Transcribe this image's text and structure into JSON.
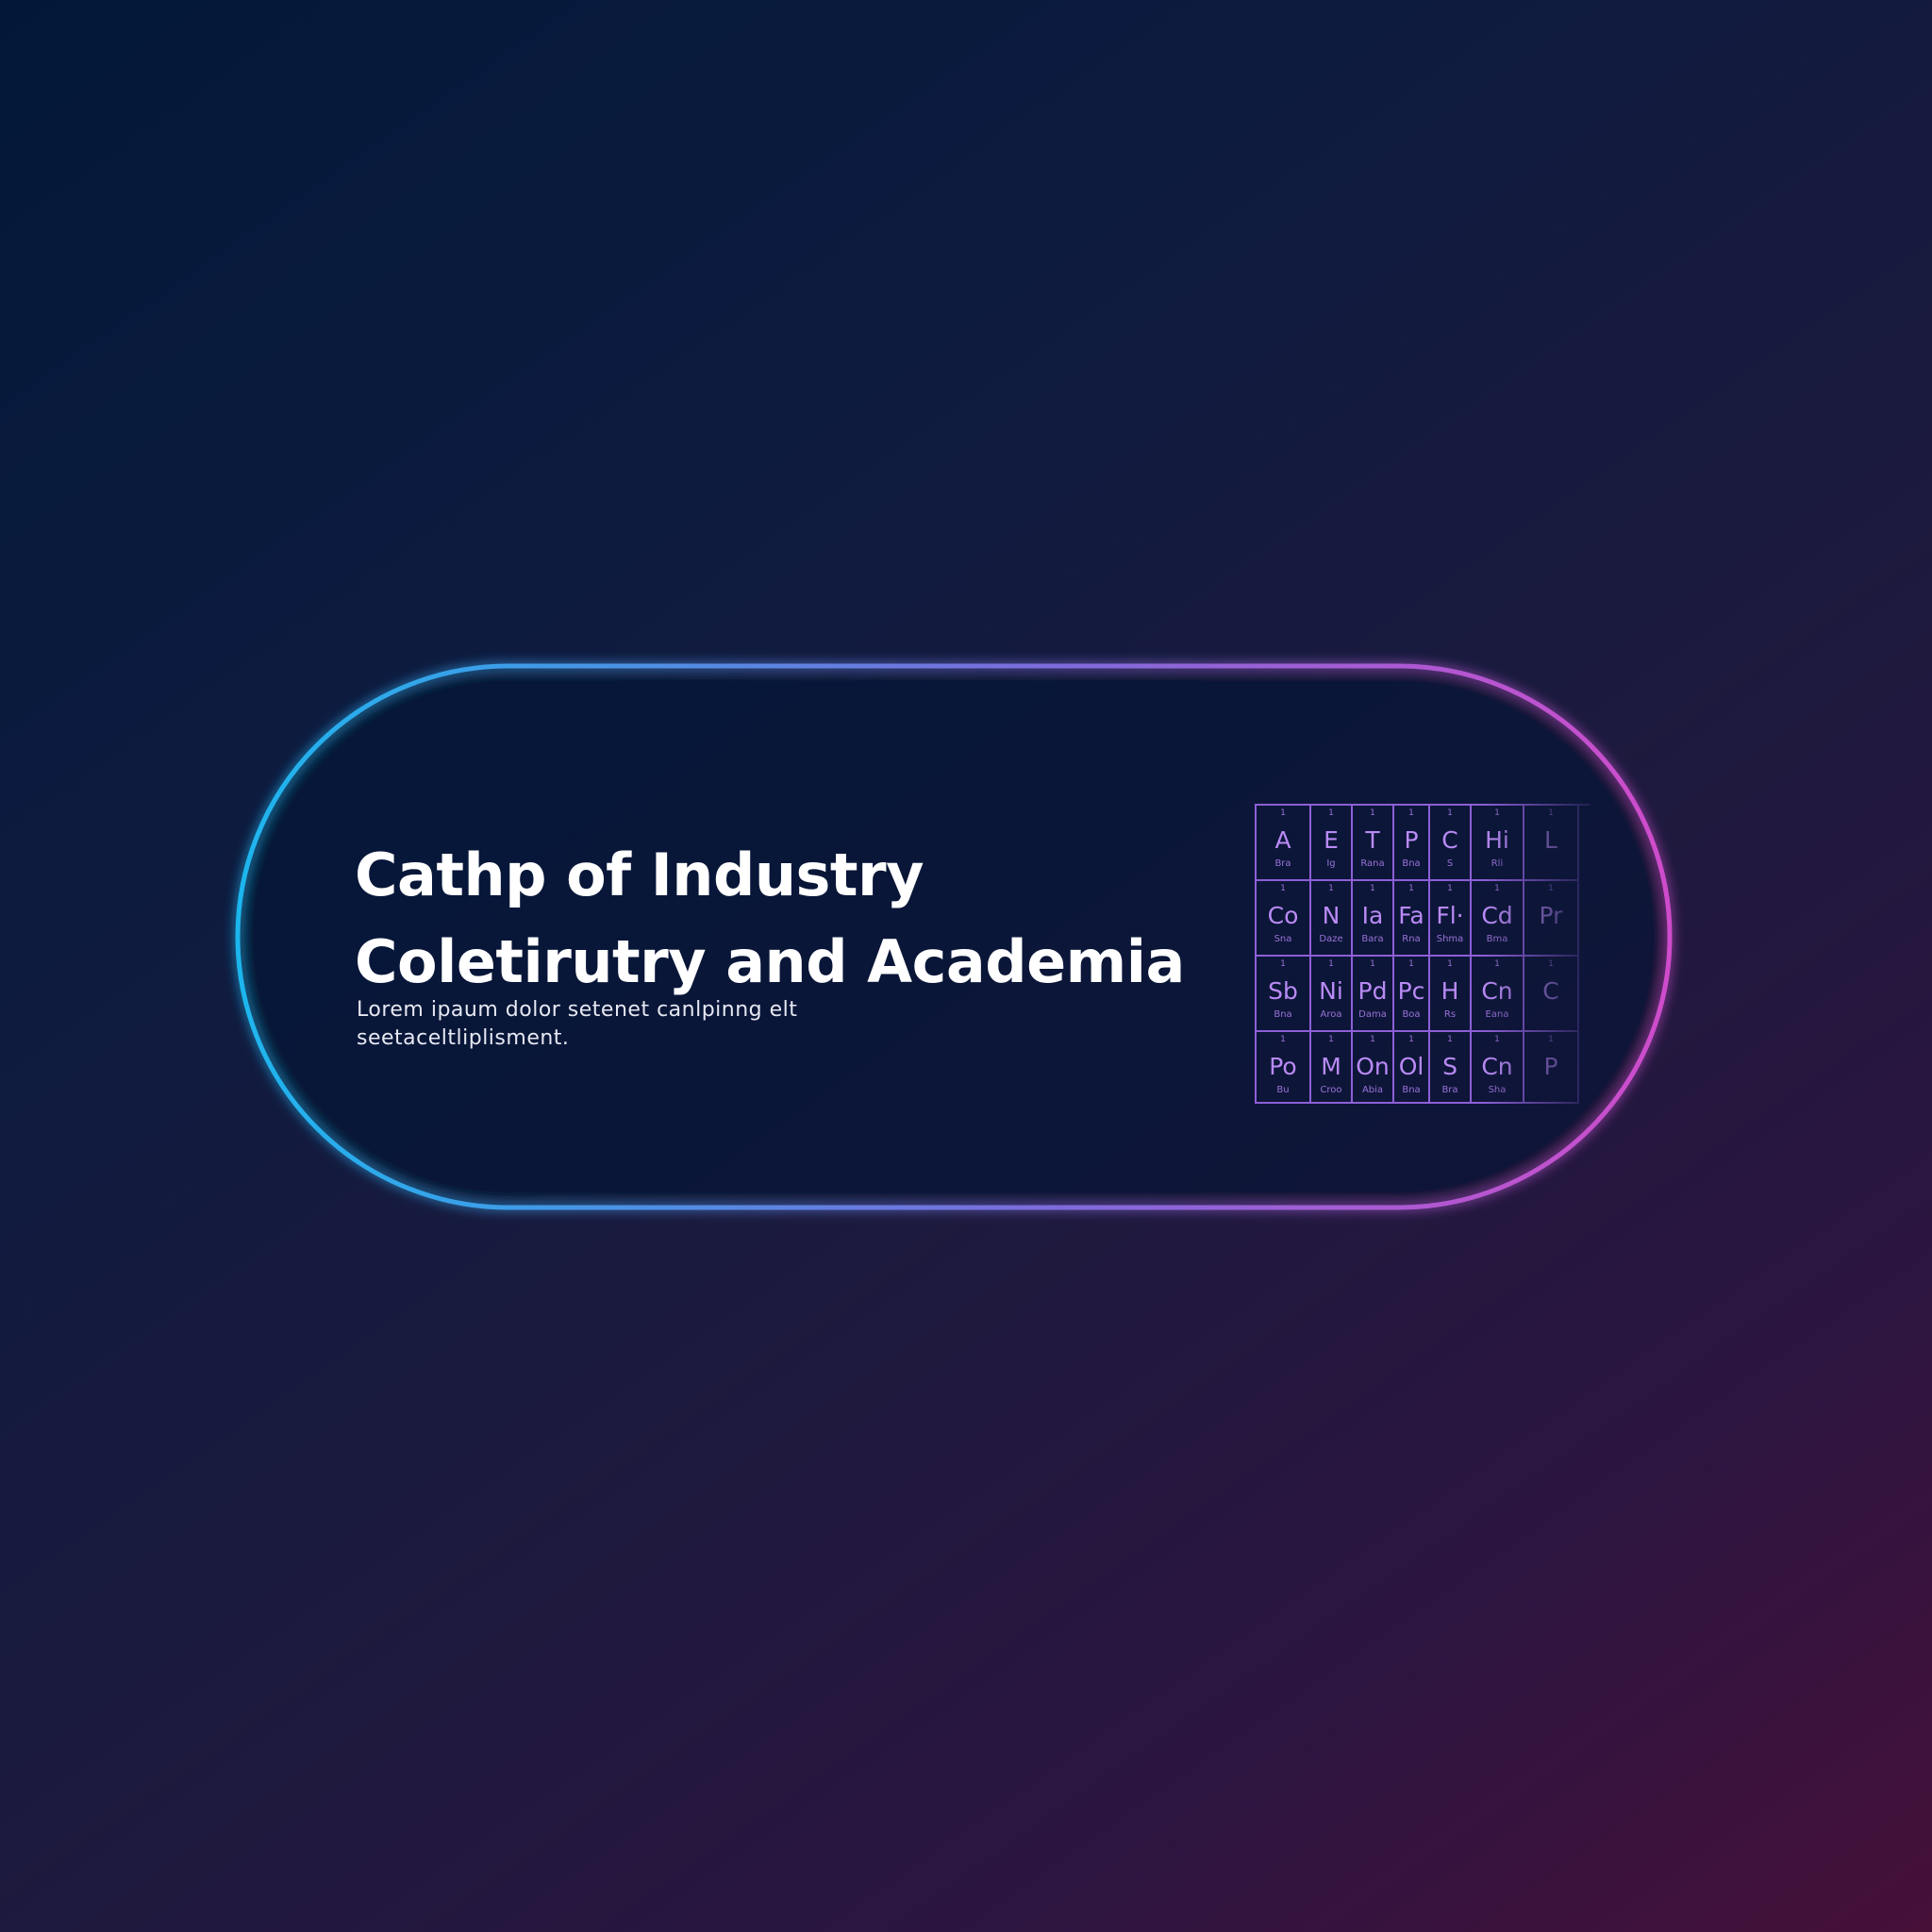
{
  "heading": {
    "line1": "Cathp of Industry",
    "line2": "Coletirutry and Academia"
  },
  "subtitle": {
    "line1": "Lorem ipaum dolor setenet canlpinng elt",
    "line2": "seetaceltliplisment."
  },
  "colors": {
    "border_start": "#1eb6ee",
    "border_end": "#cf4ccb",
    "grid": "#8d5fd6"
  },
  "periodic_table": {
    "rows": [
      [
        {
          "num": "1",
          "sym": "A",
          "name": "Bra"
        },
        {
          "num": "1",
          "sym": "E",
          "name": "Ig"
        },
        {
          "num": "1",
          "sym": "T",
          "name": "Rana"
        },
        {
          "num": "1",
          "sym": "P",
          "name": "Bna"
        },
        {
          "num": "1",
          "sym": "C",
          "name": "S"
        },
        {
          "num": "1",
          "sym": "Hi",
          "name": "Rli"
        },
        {
          "num": "1",
          "sym": "L",
          "name": ""
        }
      ],
      [
        {
          "num": "1",
          "sym": "Co",
          "name": "Sna"
        },
        {
          "num": "1",
          "sym": "N",
          "name": "Daze"
        },
        {
          "num": "1",
          "sym": "Ia",
          "name": "Bara"
        },
        {
          "num": "1",
          "sym": "Fa",
          "name": "Rna"
        },
        {
          "num": "1",
          "sym": "Fl·",
          "name": "Shma"
        },
        {
          "num": "1",
          "sym": "Cd",
          "name": "Bma"
        },
        {
          "num": "1",
          "sym": "Pr",
          "name": ""
        }
      ],
      [
        {
          "num": "1",
          "sym": "Sb",
          "name": "Bna"
        },
        {
          "num": "1",
          "sym": "Ni",
          "name": "Aroa"
        },
        {
          "num": "1",
          "sym": "Pd",
          "name": "Dama"
        },
        {
          "num": "1",
          "sym": "Pc",
          "name": "Boa"
        },
        {
          "num": "1",
          "sym": "H",
          "name": "Rs"
        },
        {
          "num": "1",
          "sym": "Cn",
          "name": "Eana"
        },
        {
          "num": "1",
          "sym": "C",
          "name": ""
        }
      ],
      [
        {
          "num": "1",
          "sym": "Po",
          "name": "Bu"
        },
        {
          "num": "1",
          "sym": "M",
          "name": "Croo"
        },
        {
          "num": "1",
          "sym": "On",
          "name": "Abia"
        },
        {
          "num": "1",
          "sym": "Ol",
          "name": "Bna"
        },
        {
          "num": "1",
          "sym": "S",
          "name": "Bra"
        },
        {
          "num": "1",
          "sym": "Cn",
          "name": "Sha"
        },
        {
          "num": "1",
          "sym": "P",
          "name": ""
        }
      ]
    ]
  }
}
